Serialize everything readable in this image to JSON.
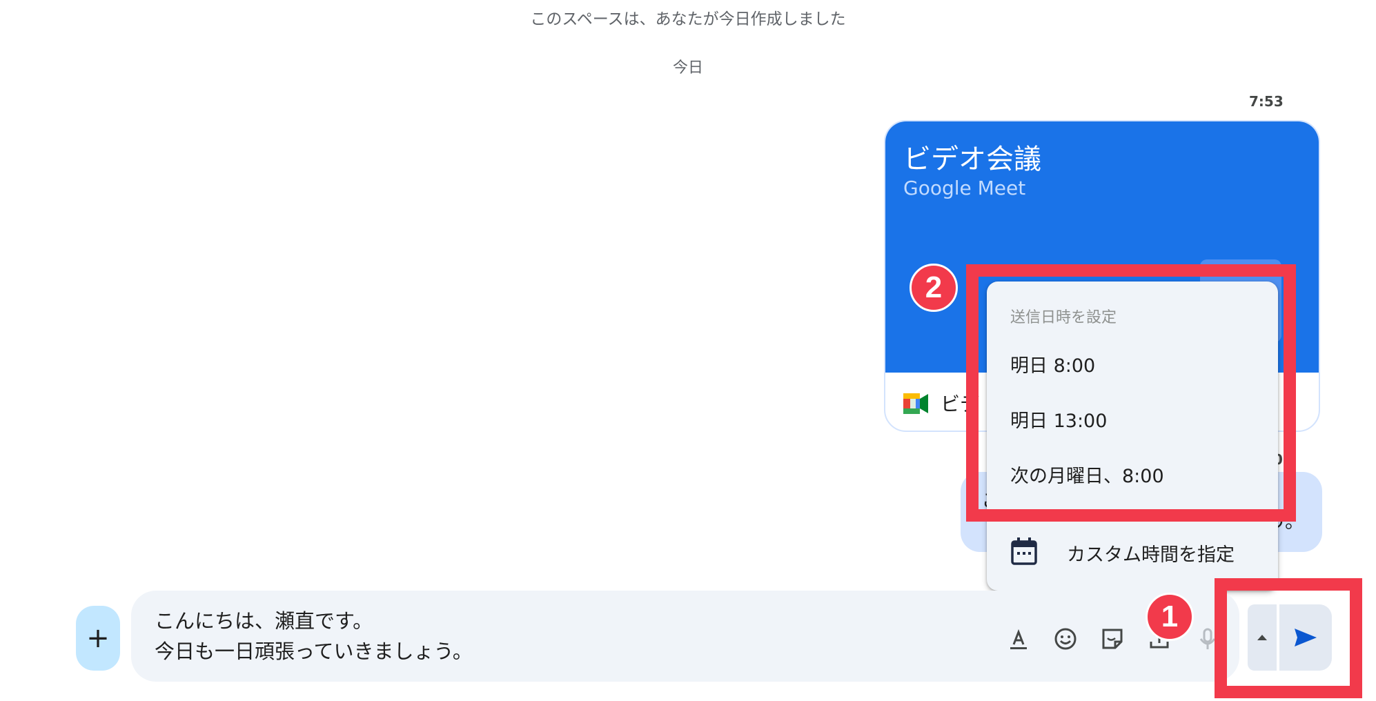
{
  "header": {
    "space_created_note": "このスペースは、あなたが今日作成しました",
    "day_separator": "今日"
  },
  "meet_message": {
    "time": "7:53",
    "title": "ビデオ会議",
    "subtitle": "Google Meet",
    "footer_label_partial": "ビデ"
  },
  "previous_message": {
    "time_partial": "0",
    "text_partial": "こ",
    "tail_partial": "う。"
  },
  "schedule_menu": {
    "header": "送信日時を設定",
    "options": [
      "明日 8:00",
      "明日 13:00",
      "次の月曜日、8:00"
    ],
    "custom_label": "カスタム時間を指定",
    "custom_icon": "calendar-icon"
  },
  "composer": {
    "add_label": "+",
    "text": "こんにちは、瀬直です。\n今日も一日頑張っていきましょう。",
    "tools": [
      "format-text-icon",
      "emoji-icon",
      "sticker-icon",
      "upload-icon",
      "mic-icon"
    ],
    "schedule_toggle_icon": "caret-up-icon",
    "send_icon": "send-icon"
  },
  "annotations": {
    "step_1": "1",
    "step_2": "2",
    "color": "#f23a4b"
  },
  "colors": {
    "meet_blue": "#1a73e8",
    "composer_bg": "#f0f4f9",
    "add_button_bg": "#c2e7ff",
    "send_icon": "#0b57d0"
  }
}
